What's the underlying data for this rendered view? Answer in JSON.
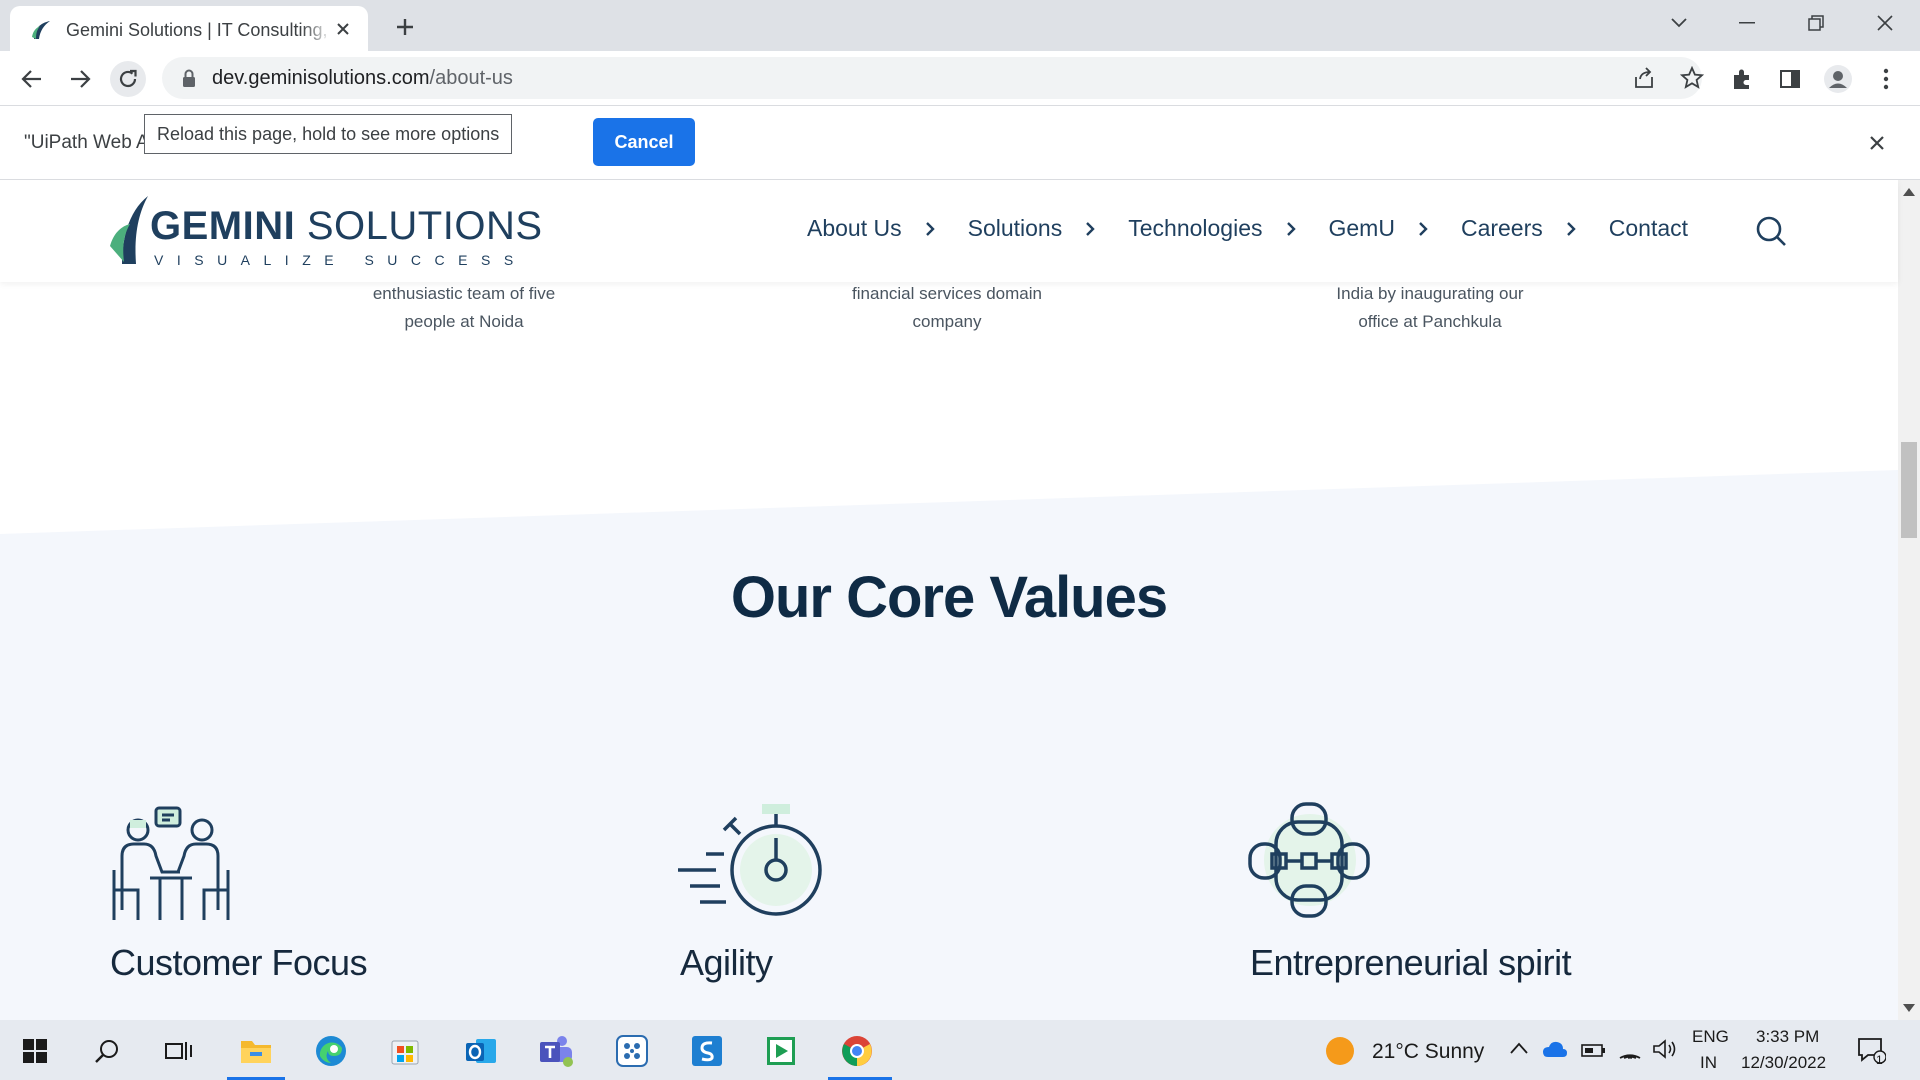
{
  "browser": {
    "tab_title": "Gemini Solutions | IT Consulting,",
    "url_host": "dev.geminisolutions.com",
    "url_path": "/about-us"
  },
  "infobar": {
    "message": "\"UiPath Web Automation\" started debugging this browser",
    "cancel_label": "Cancel"
  },
  "tooltip": "Reload this page, hold to see more options",
  "site": {
    "logo_word1": "GEMINI",
    "logo_word2": "SOLUTIONS",
    "tagline": "VISUALIZE SUCCESS",
    "nav": [
      {
        "label": "About Us"
      },
      {
        "label": "Solutions"
      },
      {
        "label": "Technologies"
      },
      {
        "label": "GemU"
      },
      {
        "label": "Careers"
      },
      {
        "label": "Contact"
      }
    ]
  },
  "timeline": [
    {
      "line1": "enthusiastic team of five",
      "line2": "people at Noida"
    },
    {
      "line1": "financial services domain",
      "line2": "company"
    },
    {
      "line1": "India by inaugurating our",
      "line2": "office at Panchkula"
    }
  ],
  "core_values": {
    "title": "Our Core Values",
    "items": [
      {
        "label": "Customer Focus",
        "icon": "customer-focus-icon"
      },
      {
        "label": "Agility",
        "icon": "stopwatch-icon"
      },
      {
        "label": "Entrepreneurial spirit",
        "icon": "network-icon"
      }
    ]
  },
  "taskbar": {
    "weather": "21°C  Sunny",
    "lang1": "ENG",
    "lang2": "IN",
    "time": "3:33 PM",
    "date": "12/30/2022",
    "notif_count": "1"
  },
  "colors": {
    "brand_navy": "#1f3f5e",
    "brand_green": "#4caf7d",
    "chrome_blue": "#1a73e8"
  }
}
